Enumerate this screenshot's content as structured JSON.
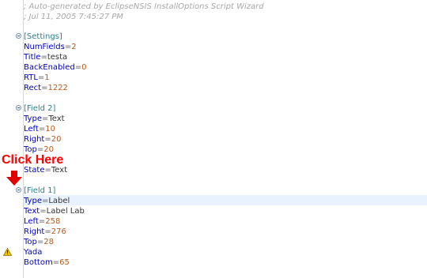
{
  "comments": [
    "; Auto-generated by EclipseNSIS InstallOptions Script Wizard",
    "; Jul 11, 2005 7:45:27 PM"
  ],
  "sections": [
    {
      "header": "[Settings]",
      "entries": [
        {
          "key": "NumFields",
          "value": "2",
          "numeric": true
        },
        {
          "key": "Title",
          "value": "testa",
          "numeric": false
        },
        {
          "key": "BackEnabled",
          "value": "0",
          "numeric": true
        },
        {
          "key": "RTL",
          "value": "1",
          "numeric": true
        },
        {
          "key": "Rect",
          "value": "1222",
          "numeric": true
        }
      ]
    },
    {
      "header": "[Field 2]",
      "entries": [
        {
          "key": "Type",
          "value": "Text",
          "numeric": false
        },
        {
          "key": "Left",
          "value": "10",
          "numeric": true
        },
        {
          "key": "Right",
          "value": "20",
          "numeric": true
        },
        {
          "key": "Top",
          "value": "20",
          "numeric": true
        },
        {
          "key": "State",
          "value": "Text",
          "numeric": false
        }
      ]
    },
    {
      "header": "[Field 1]",
      "entries": [
        {
          "key": "Type",
          "value": "Label",
          "numeric": false
        },
        {
          "key": "Text",
          "value": "Label Lab",
          "numeric": false
        },
        {
          "key": "Left",
          "value": "258",
          "numeric": true
        },
        {
          "key": "Right",
          "value": "276",
          "numeric": true
        },
        {
          "key": "Top",
          "value": "28",
          "numeric": true
        },
        {
          "key": "Yada",
          "value": "",
          "numeric": false
        },
        {
          "key": "Bottom",
          "value": "65",
          "numeric": true
        }
      ]
    }
  ],
  "callout": {
    "text": "Click Here",
    "color": "#ff0000"
  },
  "icons": {
    "fold": "collapse-icon",
    "warning": "warning-icon",
    "arrow": "arrow-down-icon"
  }
}
